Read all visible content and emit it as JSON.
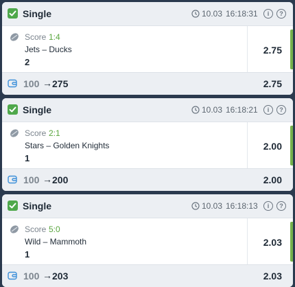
{
  "colors": {
    "page_background": "#2b3a4e",
    "check_green": "#4fa84b",
    "score_green": "#5aa63f",
    "side_bar": "#76b24c",
    "wallet_blue": "#3b8fd9"
  },
  "icons": {
    "check": "check-icon",
    "clock": "clock-icon",
    "info": "info-icon",
    "help": "help-icon",
    "sport": "hockey-puck-icon",
    "wallet": "wallet-icon"
  },
  "bets": [
    {
      "type": "Single",
      "date": "10.03",
      "time": "16:18:31",
      "info": "i",
      "help": "?",
      "score_label": "Score",
      "score_value": "1:4",
      "teams": "Jets – Ducks",
      "pick": "2",
      "odds": "2.75",
      "stake": "100",
      "arrow": "→",
      "payout": "275",
      "total_odds": "2.75"
    },
    {
      "type": "Single",
      "date": "10.03",
      "time": "16:18:21",
      "info": "i",
      "help": "?",
      "score_label": "Score",
      "score_value": "2:1",
      "teams": "Stars – Golden Knights",
      "pick": "1",
      "odds": "2.00",
      "stake": "100",
      "arrow": "→",
      "payout": "200",
      "total_odds": "2.00"
    },
    {
      "type": "Single",
      "date": "10.03",
      "time": "16:18:13",
      "info": "i",
      "help": "?",
      "score_label": "Score",
      "score_value": "5:0",
      "teams": "Wild – Mammoth",
      "pick": "1",
      "odds": "2.03",
      "stake": "100",
      "arrow": "→",
      "payout": "203",
      "total_odds": "2.03"
    }
  ]
}
